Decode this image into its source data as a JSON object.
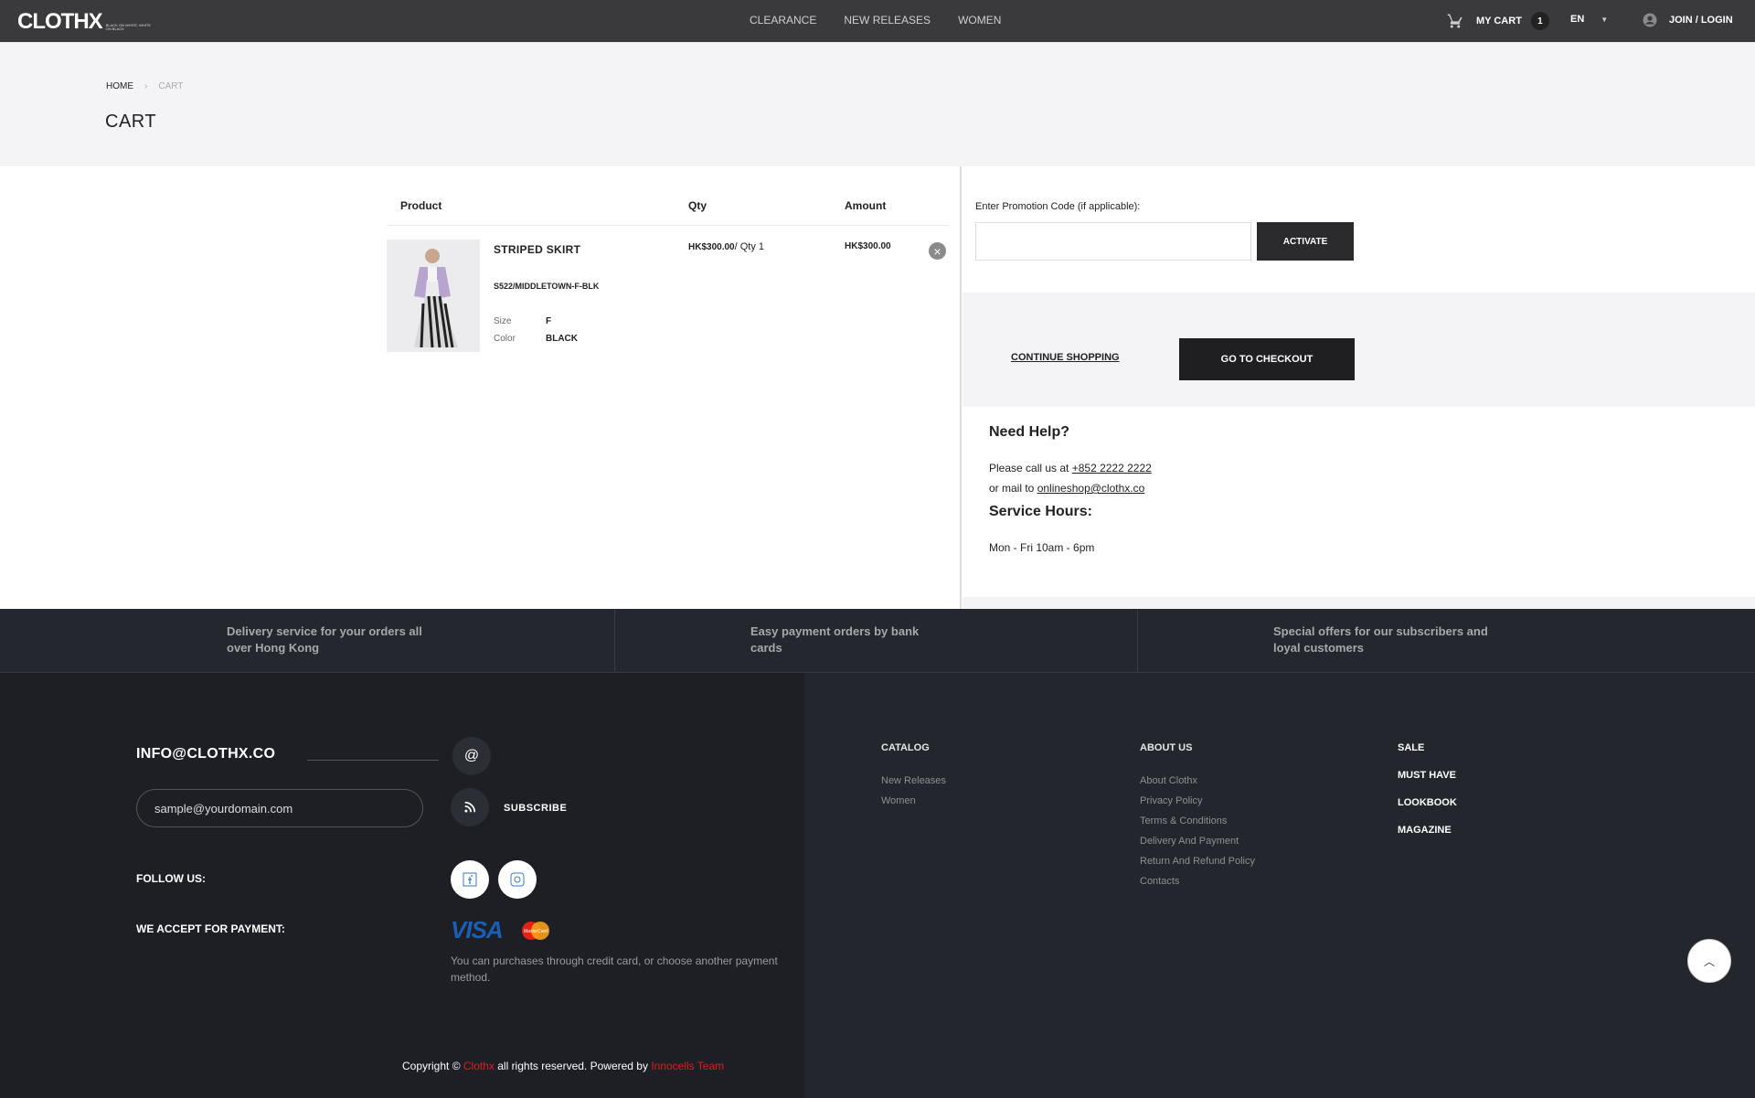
{
  "header": {
    "logo": "CLOTHX",
    "logo_tagline": "BLACK ON WHITE, WHITE ON BLACK",
    "nav": [
      "CLEARANCE",
      "NEW RELEASES",
      "WOMEN"
    ],
    "cart_label": "MY CART",
    "cart_count": "1",
    "language": "EN",
    "login_label": "JOIN / LOGIN"
  },
  "breadcrumb": {
    "home": "HOME",
    "separator": "›",
    "current": "CART"
  },
  "page_title": "CART",
  "cart_table": {
    "headers": {
      "product": "Product",
      "qty": "Qty",
      "amount": "Amount"
    },
    "items": [
      {
        "name": "STRIPED SKIRT",
        "sku": "S522/MIDDLETOWN-F-BLK",
        "size_label": "Size",
        "size": "F",
        "color_label": "Color",
        "color": "BLACK",
        "unit_price": "HK$300.00",
        "qty_text": "/ Qty 1",
        "amount": "HK$300.00",
        "remove_icon": "close-icon"
      }
    ]
  },
  "promo": {
    "label": "Enter Promotion Code (if applicable):",
    "input_value": "",
    "button": "ACTIVATE"
  },
  "actions": {
    "continue": "CONTINUE SHOPPING",
    "checkout": "GO TO CHECKOUT"
  },
  "help": {
    "title": "Need Help?",
    "call_prefix": "Please call us at ",
    "phone": "+852 2222 2222",
    "mail_prefix": "or mail to ",
    "email": "onlineshop@clothx.co",
    "hours_title": "Service Hours:",
    "hours": "Mon - Fri 10am - 6pm"
  },
  "features": [
    "Delivery service for your orders all over Hong Kong",
    "Easy payment orders by bank cards",
    "Special offers for our subscribers and loyal customers"
  ],
  "footer": {
    "contact_email": "INFO@CLOTHX.CO",
    "subscribe_placeholder": "sample@yourdomain.com",
    "subscribe_label": "SUBSCRIBE",
    "follow_label": "FOLLOW US:",
    "payment_label": "WE ACCEPT FOR PAYMENT:",
    "visa": "VISA",
    "mastercard": "MasterCard",
    "payment_note": "You can purchases through credit card, or choose another payment method.",
    "copyright_prefix": "Copyright © ",
    "copyright_brand": "Clothx",
    "copyright_mid": " all rights reserved. Powered by ",
    "copyright_team": "Innocells Team",
    "catalog": {
      "title": "CATALOG",
      "items": [
        "New Releases",
        "Women"
      ]
    },
    "about": {
      "title": "ABOUT US",
      "items": [
        "About Clothx",
        "Privacy Policy",
        "Terms & Conditions",
        "Delivery And Payment",
        "Return And Refund Policy",
        "Contacts"
      ]
    },
    "extra_links": [
      "SALE",
      "MUST HAVE",
      "LOOKBOOK",
      "MAGAZINE"
    ]
  },
  "colors": {
    "header_bg": "#3a3a3c",
    "footer_bg": "#1d1f25",
    "accent_red": "#d72020",
    "button_dark": "#1f1f22"
  }
}
